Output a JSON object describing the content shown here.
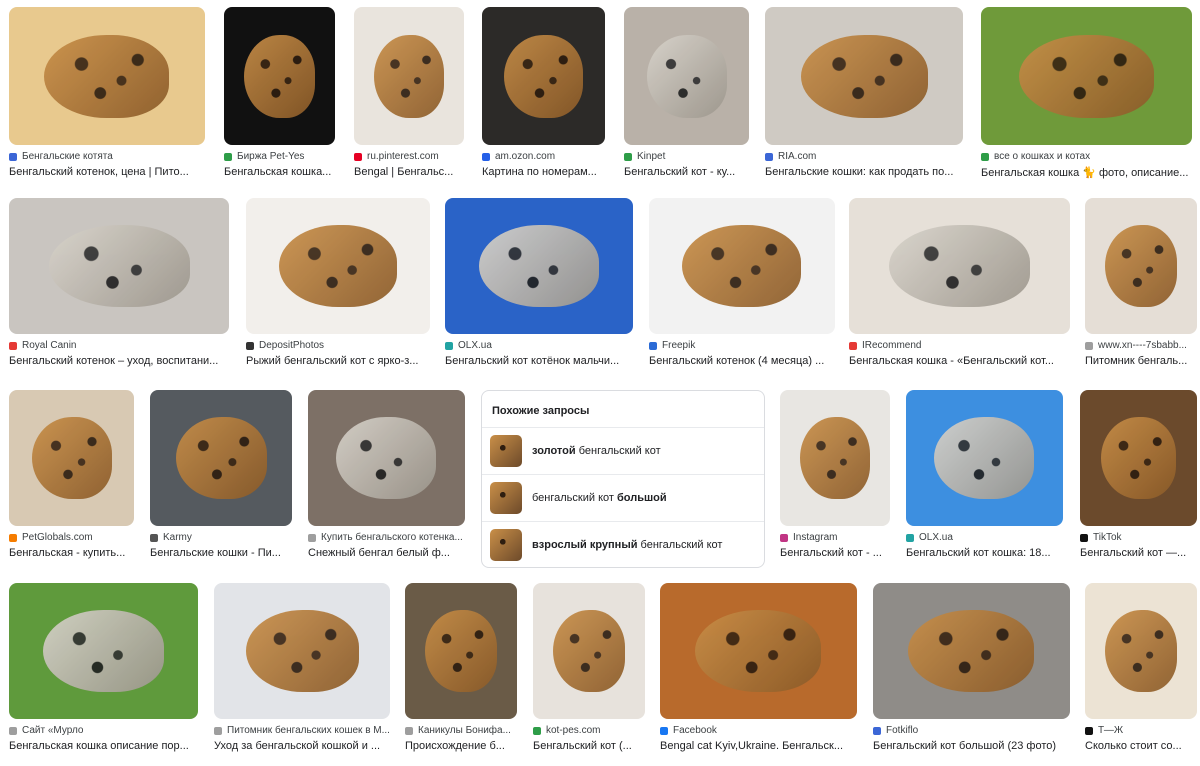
{
  "results": [
    {
      "source": "Бенгальские котята",
      "title": "Бенгальский котенок, цена | Пито...",
      "bg": "#e8c98e",
      "fav": "#3b66d6",
      "cat": "gold"
    },
    {
      "source": "Биржа Pet-Yes",
      "title": "Бенгальская кошка...",
      "bg": "#111111",
      "fav": "#2e9d48",
      "cat": "gold"
    },
    {
      "source": "ru.pinterest.com",
      "title": "Bengal | Бенгальс...",
      "bg": "#e9e4dd",
      "fav": "#e60023",
      "cat": "gold"
    },
    {
      "source": "am.ozon.com",
      "title": "Картина по номерам...",
      "bg": "#2c2a28",
      "fav": "#2560e8",
      "cat": "gold"
    },
    {
      "source": "Kinpet",
      "title": "Бенгальский кот - ку...",
      "bg": "#b9b1a8",
      "fav": "#2e9d48",
      "cat": "silver"
    },
    {
      "source": "RIA.com",
      "title": "Бенгальские кошки: как продать по...",
      "bg": "#cfcac3",
      "fav": "#3b66d6",
      "cat": "gold"
    },
    {
      "source": "все о кошках и котах",
      "title": "Бенгальская кошка 🐈 фото, описание...",
      "bg": "#6f9a3a",
      "fav": "#2e9d48",
      "cat": "gold"
    },
    {
      "source": "Royal Canin",
      "title": "Бенгальский котенок – уход, воспитани...",
      "bg": "#c9c5c0",
      "fav": "#e53935",
      "cat": "silver"
    },
    {
      "source": "DepositPhotos",
      "title": "Рыжий бенгальский кот с ярко-з...",
      "bg": "#f2efeb",
      "fav": "#333333",
      "cat": "gold"
    },
    {
      "source": "OLX.ua",
      "title": "Бенгальский кот котёнок мальчи...",
      "bg": "#2a63c7",
      "fav": "#22a3a3",
      "cat": "silver"
    },
    {
      "source": "Freepik",
      "title": "Бенгальский котенок (4 месяца) ...",
      "bg": "#f2f2f2",
      "fav": "#2b6bd6",
      "cat": "gold"
    },
    {
      "source": "IRecommend",
      "title": "Бенгальская кошка - «Бенгальский кот...",
      "bg": "#e6e0d8",
      "fav": "#e53935",
      "cat": "silver"
    },
    {
      "source": "www.xn----7sbabb...",
      "title": "Питомник бенгаль...",
      "bg": "#e5ded6",
      "fav": "#9e9e9e",
      "cat": "gold"
    },
    {
      "source": "PetGlobals.com",
      "title": "Бенгальская - купить...",
      "bg": "#d8c9b3",
      "fav": "#f57c00",
      "cat": "gold"
    },
    {
      "source": "Karmy",
      "title": "Бенгальские кошки - Пи...",
      "bg": "#555a5f",
      "fav": "#555555",
      "cat": "gold"
    },
    {
      "source": "Купить бенгальского котенка...",
      "title": "Снежный бенгал белый ф...",
      "bg": "#7d7066",
      "fav": "#9e9e9e",
      "cat": "silver"
    },
    {
      "source": "Instagram",
      "title": "Бенгальский кот - ...",
      "bg": "#e8e6e2",
      "fav": "#c13584",
      "cat": "gold"
    },
    {
      "source": "OLX.ua",
      "title": "Бенгальский кот кошка: 18...",
      "bg": "#3d8fe0",
      "fav": "#22a3a3",
      "cat": "silver"
    },
    {
      "source": "TikTok",
      "title": "Бенгальский кот —...",
      "bg": "#6b4a2c",
      "fav": "#111111",
      "cat": "gold"
    },
    {
      "source": "Сайт «Мурло",
      "title": "Бенгальская кошка описание пор...",
      "bg": "#5f9a3c",
      "fav": "#9e9e9e",
      "cat": "silver"
    },
    {
      "source": "Питомник бенгальских кошек в М...",
      "title": "Уход за бенгальской кошкой и ...",
      "bg": "#e2e4e8",
      "fav": "#9e9e9e",
      "cat": "gold"
    },
    {
      "source": "Каникулы Бонифа...",
      "title": "Происхождение б...",
      "bg": "#6a5b47",
      "fav": "#9e9e9e",
      "cat": "gold"
    },
    {
      "source": "kot-pes.com",
      "title": "Бенгальский кот (...",
      "bg": "#e7e2dc",
      "fav": "#2e9d48",
      "cat": "gold"
    },
    {
      "source": "Facebook",
      "title": "Bengal cat Kyiv,Ukraine. Бенгальск...",
      "bg": "#b86a2c",
      "fav": "#1877f2",
      "cat": "gold"
    },
    {
      "source": "Fotkiflo",
      "title": "Бенгальский кот большой (23 фото)",
      "bg": "#8f8c88",
      "fav": "#3b66d6",
      "cat": "gold"
    },
    {
      "source": "Т—Ж",
      "title": "Сколько стоит со...",
      "bg": "#ece3d4",
      "fav": "#111111",
      "cat": "gold"
    }
  ],
  "related": {
    "heading": "Похожие запросы",
    "items": [
      {
        "bold": "золотой",
        "rest": " бенгальский кот",
        "bold_first": true
      },
      {
        "bold": "большой",
        "rest": "бенгальский кот ",
        "bold_first": false
      },
      {
        "bold": "взрослый крупный",
        "rest": " бенгальский кот",
        "bold_first": true
      }
    ]
  }
}
